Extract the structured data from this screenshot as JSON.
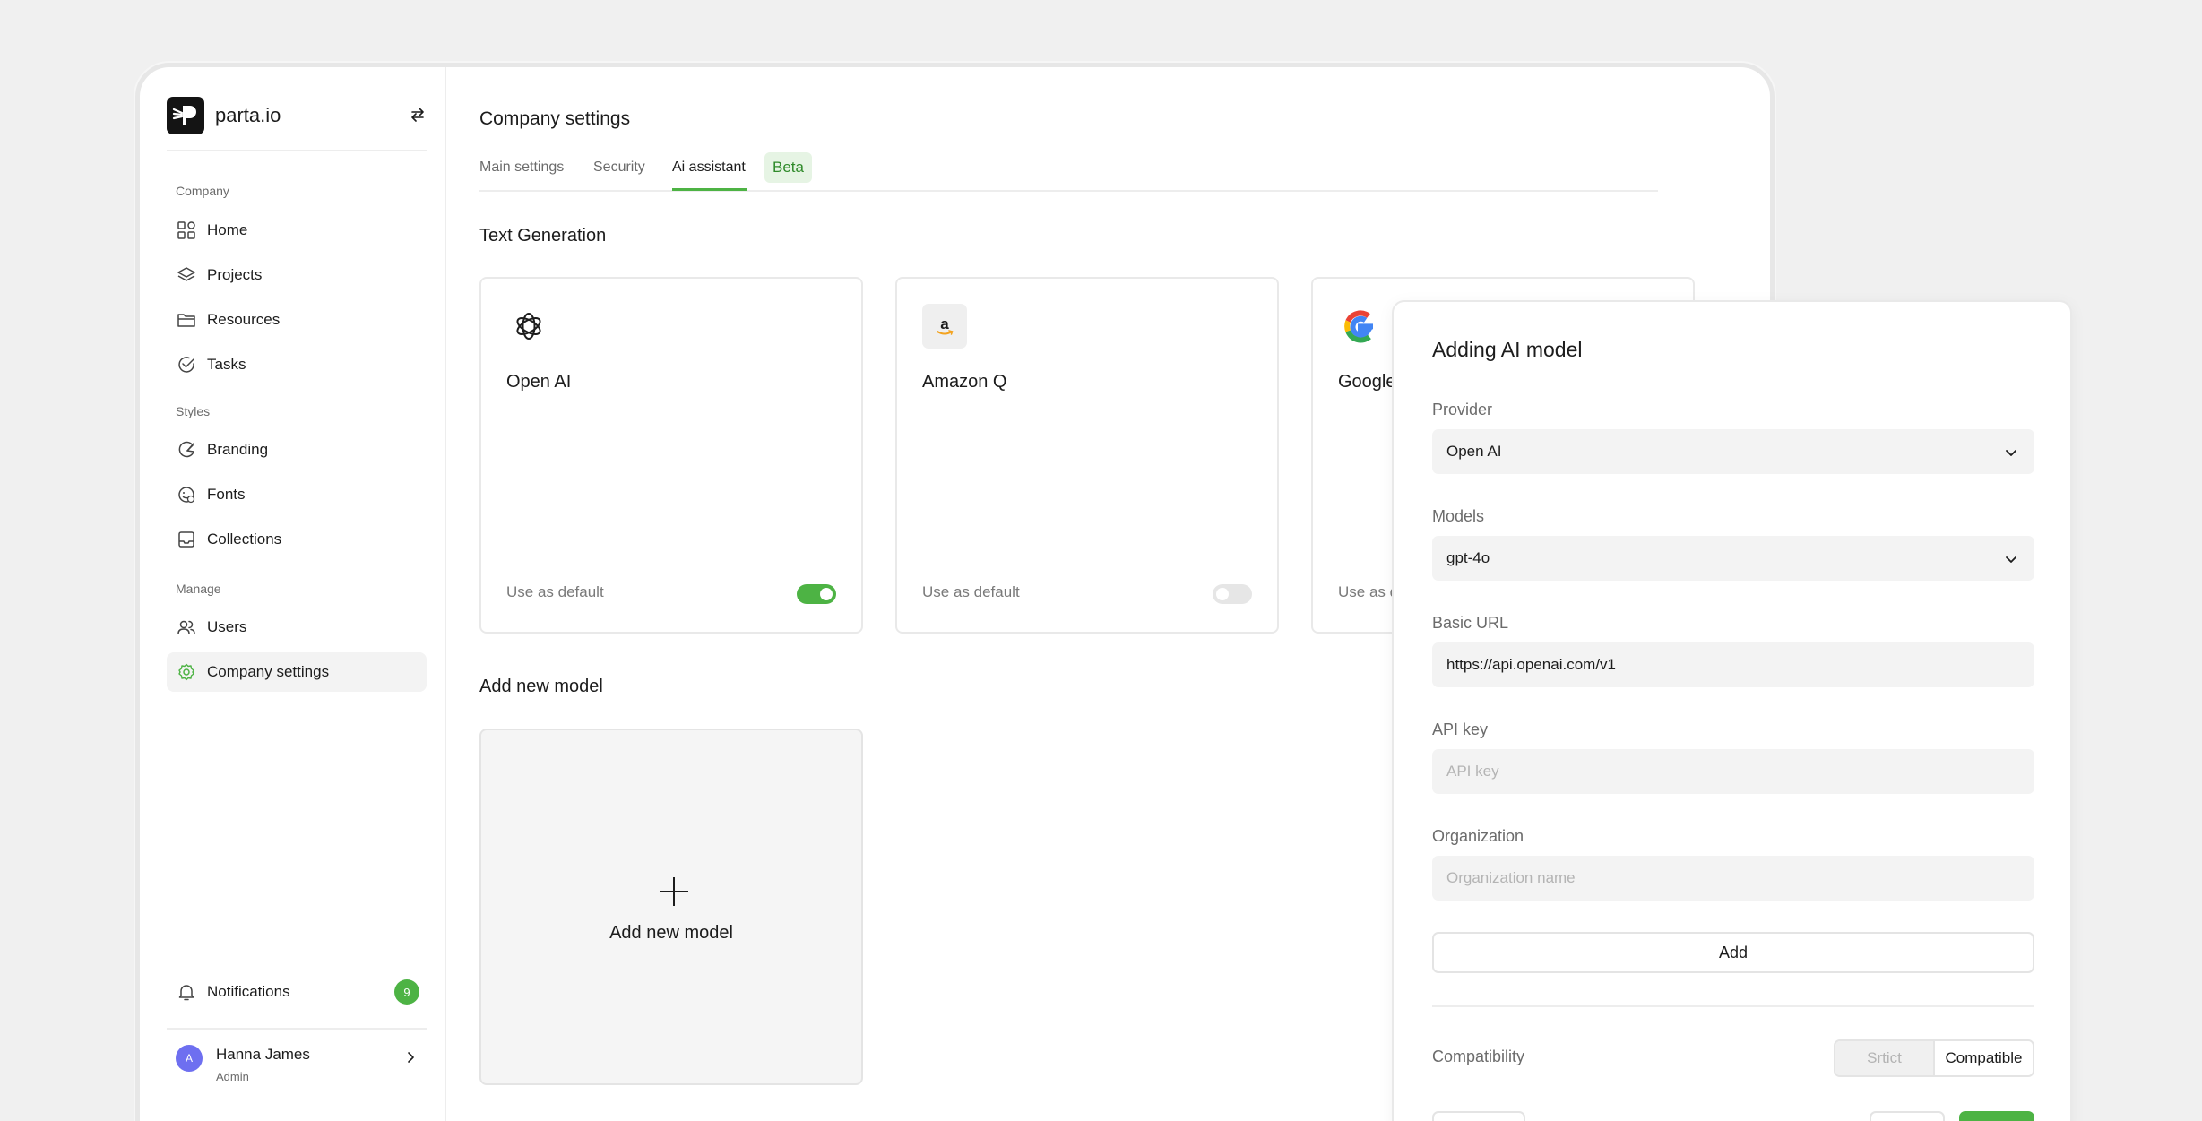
{
  "brand": {
    "name": "parta.io"
  },
  "sidebar": {
    "sections": {
      "company": "Company",
      "styles": "Styles",
      "manage": "Manage"
    },
    "items": {
      "home": "Home",
      "projects": "Projects",
      "resources": "Resources",
      "tasks": "Tasks",
      "branding": "Branding",
      "fonts": "Fonts",
      "collections": "Collections",
      "users": "Users",
      "company_settings": "Company settings"
    },
    "active": "company_settings",
    "notifications": {
      "label": "Notifications",
      "count": "9"
    },
    "user": {
      "initial": "A",
      "name": "Hanna James",
      "role": "Admin"
    }
  },
  "page": {
    "title": "Company settings",
    "tabs": {
      "main": "Main settings",
      "security": "Security",
      "ai": "Ai assistant",
      "beta": "Beta"
    },
    "active_tab": "ai"
  },
  "text_generation": {
    "title": "Text Generation",
    "cards": [
      {
        "name": "Open AI",
        "icon": "openai-icon",
        "default_label": "Use as default",
        "default_on": true
      },
      {
        "name": "Amazon Q",
        "icon": "amazon-icon",
        "default_label": "Use as default",
        "default_on": false
      },
      {
        "name": "Google",
        "icon": "google-icon",
        "default_label": "Use as default",
        "default_on": false
      }
    ]
  },
  "add_model": {
    "title": "Add new model",
    "card_label": "Add new model"
  },
  "modal": {
    "title": "Adding AI model",
    "provider": {
      "label": "Provider",
      "value": "Open AI"
    },
    "models": {
      "label": "Models",
      "value": "gpt-4o"
    },
    "basic_url": {
      "label": "Basic URL",
      "value": "https://api.openai.com/v1"
    },
    "api_key": {
      "label": "API key",
      "placeholder": "API key"
    },
    "organization": {
      "label": "Organization",
      "placeholder": "Organization name"
    },
    "add_button": "Add",
    "compatibility": {
      "label": "Compatibility",
      "options": [
        "Srtict",
        "Compatible"
      ],
      "selected": "Compatible"
    }
  },
  "colors": {
    "accent": "#4db344",
    "avatar": "#6e6ff0",
    "beta_bg": "#e6f4e4",
    "beta_text": "#2f8a2a"
  }
}
